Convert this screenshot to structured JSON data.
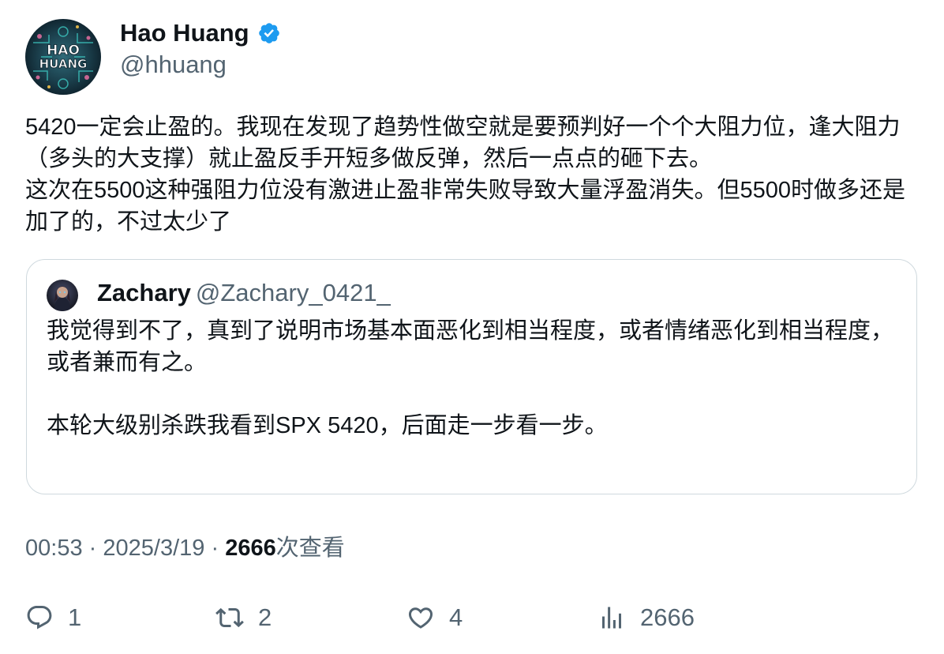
{
  "author": {
    "display_name": "Hao Huang",
    "handle": "@hhuang",
    "verified": true,
    "avatar_text": "HAO HUANG",
    "verified_color": "#1d9bf0"
  },
  "tweet": {
    "text": "5420一定会止盈的。我现在发现了趋势性做空就是要预判好一个个大阻力位，逢大阻力（多头的大支撑）就止盈反手开短多做反弹，然后一点点的砸下去。\n这次在5500这种强阻力位没有激进止盈非常失败导致大量浮盈消失。但5500时做多还是加了的，不过太少了"
  },
  "quote": {
    "display_name": "Zachary",
    "handle": "@Zachary_0421_",
    "text": "我觉得到不了，真到了说明市场基本面恶化到相当程度，或者情绪恶化到相当程度，或者兼而有之。\n\n本轮大级别杀跌我看到SPX 5420，后面走一步看一步。"
  },
  "meta": {
    "time": "00:53",
    "separator": "·",
    "date": "2025/3/19",
    "views_count": "2666",
    "views_label": "次查看"
  },
  "actions": {
    "replies": "1",
    "retweets": "2",
    "likes": "4",
    "views": "2666",
    "icons": [
      "reply-icon",
      "retweet-icon",
      "like-icon",
      "views-icon"
    ]
  }
}
